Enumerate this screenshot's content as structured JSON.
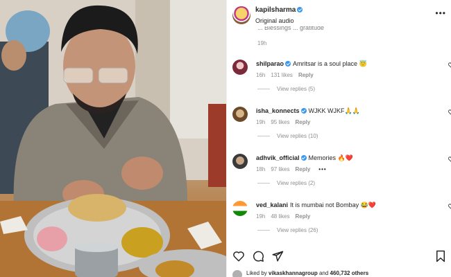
{
  "header": {
    "username": "kapilsharma",
    "audio": "Original audio",
    "more_icon": "more-horizontal-icon"
  },
  "clipped": {
    "text": "... Blessings ... gratitude",
    "time": "19h"
  },
  "comments": [
    {
      "username": "shilparao",
      "verified": true,
      "text": "Amritsar is a soul place 😇",
      "time": "16h",
      "likes": "131 likes",
      "reply": "Reply",
      "view_replies": "View replies (5)"
    },
    {
      "username": "isha_konnects",
      "verified": true,
      "text": "WJKK WJKF🙏🙏",
      "time": "19h",
      "likes": "95 likes",
      "reply": "Reply",
      "view_replies": "View replies (10)"
    },
    {
      "username": "adhvik_official",
      "verified": true,
      "text": "Memories 🔥❤️",
      "time": "18h",
      "likes": "97 likes",
      "reply": "Reply",
      "options": "•••",
      "view_replies": "View replies (2)"
    },
    {
      "username": "ved_kalani",
      "verified": false,
      "text": "It is mumbai not Bombay 😂❤️",
      "time": "19h",
      "likes": "48 likes",
      "reply": "Reply",
      "view_replies": "View replies (26)"
    }
  ],
  "actions": {
    "like_icon": "heart-icon",
    "comment_icon": "comment-icon",
    "share_icon": "send-icon",
    "save_icon": "bookmark-icon"
  },
  "likes": {
    "prefix": "Liked by",
    "user": "vikaskhannagroup",
    "connector": "and",
    "others": "460,732 others"
  },
  "colors": {
    "verified": "#3897f0",
    "heart": "#ed4956",
    "muted": "#8e8e8e"
  }
}
